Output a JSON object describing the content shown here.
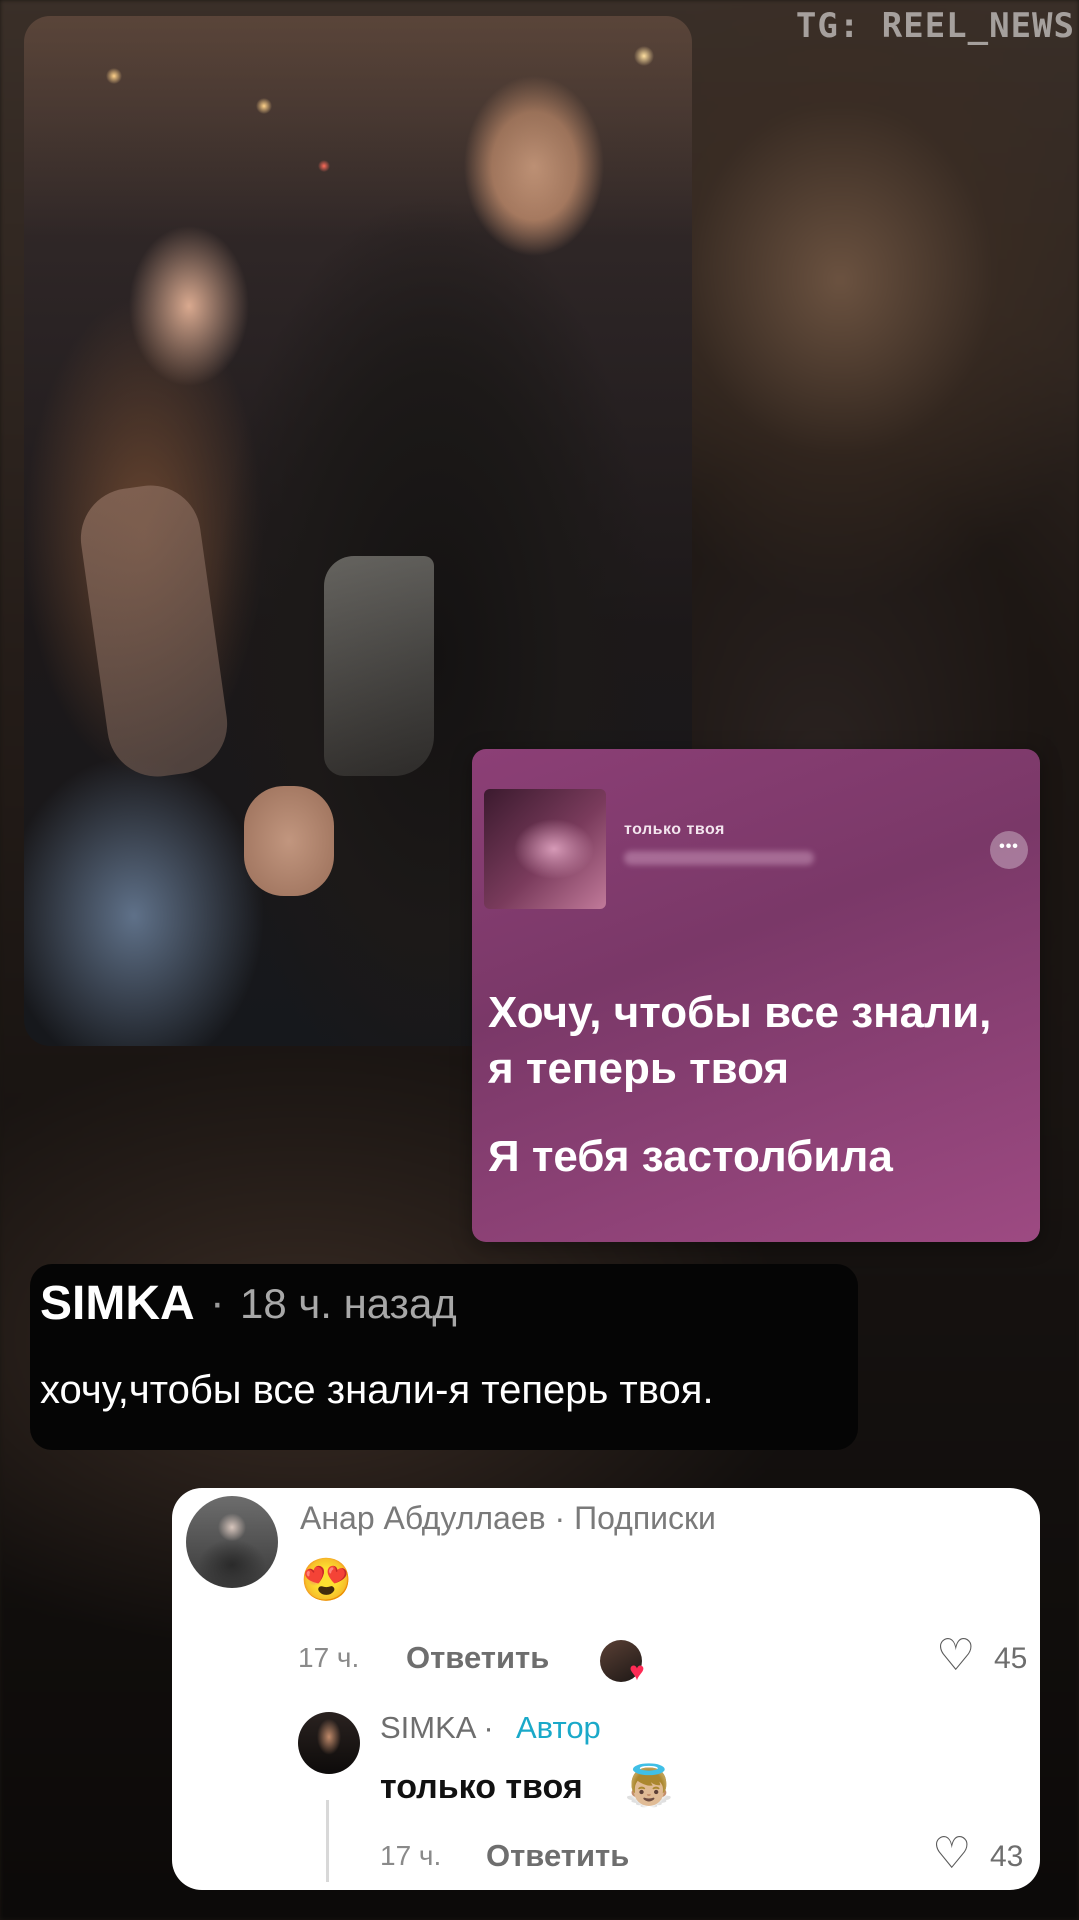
{
  "watermark": "TG: REEL_NEWS",
  "music_card": {
    "song_title": "только твоя",
    "more_icon": "•••",
    "lyrics": [
      "Хочу, чтобы все знали,",
      "я теперь твоя",
      "Я тебя застолбила"
    ]
  },
  "caption": {
    "author": "SIMKA",
    "separator": "·",
    "time": "18 ч. назад",
    "text": "хочу,чтобы все знали-я теперь твоя."
  },
  "comments": [
    {
      "author": "Анар Абдуллаев · Подписки",
      "text": "😍",
      "time": "17 ч.",
      "reply_label": "Ответить",
      "likes": "45",
      "liked_by_creator_icon": "heart-icon"
    },
    {
      "author": "SIMKA ·",
      "badge": "Автор",
      "text": "только твоя",
      "emoji": "👼🏼",
      "time": "17 ч.",
      "reply_label": "Ответить",
      "likes": "43"
    }
  ],
  "colors": {
    "author_badge": "#1aa9c9",
    "music_card_bg": "#8c3f76",
    "liked_heart": "#ff2b55"
  }
}
